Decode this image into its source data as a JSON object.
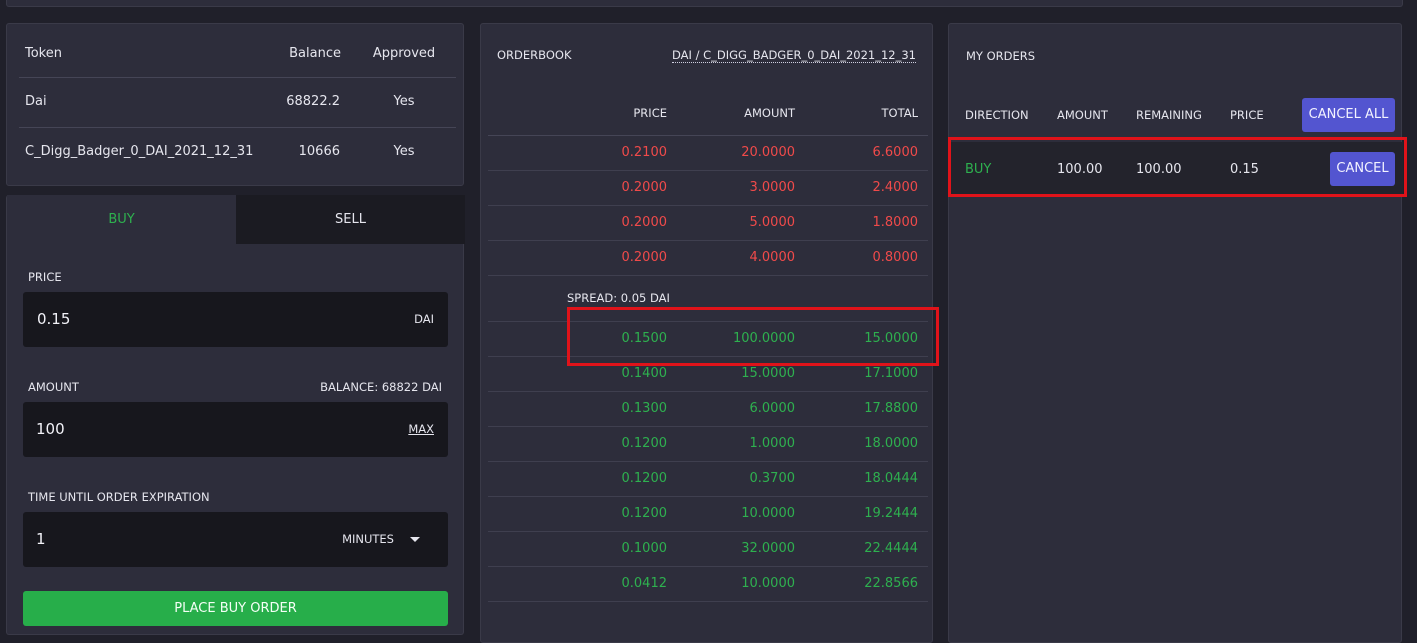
{
  "token_table": {
    "headers": {
      "token": "Token",
      "balance": "Balance",
      "approved": "Approved"
    },
    "rows": [
      {
        "token": "Dai",
        "balance": "68822.2",
        "approved": "Yes"
      },
      {
        "token": "C_Digg_Badger_0_DAI_2021_12_31",
        "balance": "10666",
        "approved": "Yes"
      }
    ]
  },
  "trade_form": {
    "tabs": {
      "buy": "BUY",
      "sell": "SELL"
    },
    "price_label": "PRICE",
    "price_value": "0.15",
    "price_unit": "DAI",
    "amount_label": "AMOUNT",
    "balance_text": "BALANCE: 68822 DAI",
    "amount_value": "100",
    "max_label": "MAX",
    "expiration_label": "TIME UNTIL ORDER EXPIRATION",
    "expiration_value": "1",
    "expiration_unit": "MINUTES",
    "submit_label": "PLACE BUY ORDER"
  },
  "orderbook": {
    "title": "ORDERBOOK",
    "pair": "DAI / C_DIGG_BADGER_0_DAI_2021_12_31",
    "headers": {
      "price": "PRICE",
      "amount": "AMOUNT",
      "total": "TOTAL"
    },
    "asks": [
      {
        "price": "0.2100",
        "amount": "20.0000",
        "total": "6.6000"
      },
      {
        "price": "0.2000",
        "amount": "3.0000",
        "total": "2.4000"
      },
      {
        "price": "0.2000",
        "amount": "5.0000",
        "total": "1.8000"
      },
      {
        "price": "0.2000",
        "amount": "4.0000",
        "total": "0.8000"
      }
    ],
    "spread": "SPREAD: 0.05 DAI",
    "bids": [
      {
        "price": "0.1500",
        "amount": "100.0000",
        "total": "15.0000"
      },
      {
        "price": "0.1400",
        "amount": "15.0000",
        "total": "17.1000"
      },
      {
        "price": "0.1300",
        "amount": "6.0000",
        "total": "17.8800"
      },
      {
        "price": "0.1200",
        "amount": "1.0000",
        "total": "18.0000"
      },
      {
        "price": "0.1200",
        "amount": "0.3700",
        "total": "18.0444"
      },
      {
        "price": "0.1200",
        "amount": "10.0000",
        "total": "19.2444"
      },
      {
        "price": "0.1000",
        "amount": "32.0000",
        "total": "22.4444"
      },
      {
        "price": "0.0412",
        "amount": "10.0000",
        "total": "22.8566"
      }
    ]
  },
  "my_orders": {
    "title": "MY ORDERS",
    "headers": {
      "direction": "DIRECTION",
      "amount": "AMOUNT",
      "remaining": "REMAINING",
      "price": "PRICE"
    },
    "cancel_all_label": "CANCEL ALL",
    "orders": [
      {
        "direction": "BUY",
        "amount": "100.00",
        "remaining": "100.00",
        "price": "0.15",
        "cancel_label": "CANCEL"
      }
    ]
  },
  "colors": {
    "ask": "#f04a4a",
    "bid": "#2eb04f",
    "button": "#5355d0",
    "submit": "#27ae4a",
    "highlight": "#e0131a"
  }
}
